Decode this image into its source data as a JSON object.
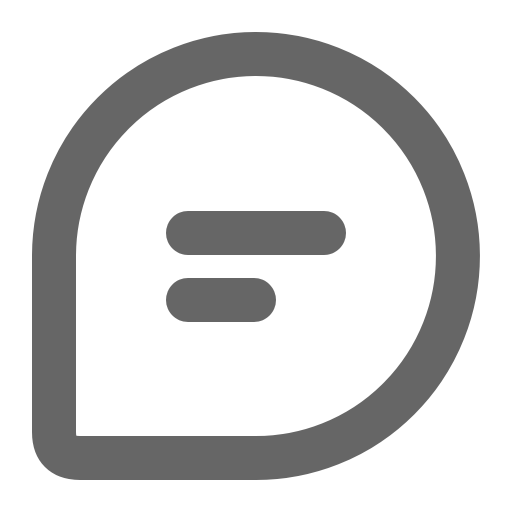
{
  "icon": {
    "name": "chat-bubble-icon",
    "color": "#666666",
    "background": "#ffffff"
  }
}
